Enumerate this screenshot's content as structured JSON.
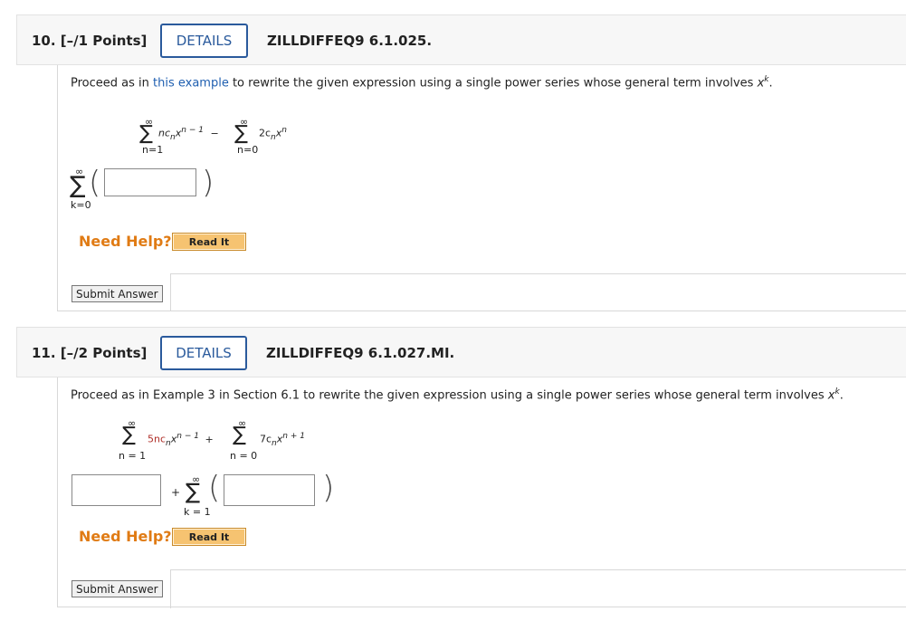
{
  "q10": {
    "number": "10.  [–/1 Points]",
    "details": "DETAILS",
    "code": "ZILLDIFFEQ9 6.1.025.",
    "prompt_before": "Proceed as in ",
    "prompt_link": "this example",
    "prompt_after": " to rewrite the given expression using a single power series whose general term involves ",
    "prompt_var": "x",
    "prompt_exp": "k",
    "prompt_end": ".",
    "expr": {
      "inf1": "∞",
      "inf2": "∞",
      "term1": "nc",
      "term1_sub": "n",
      "term1_x": "x",
      "term1_sup": "n − 1",
      "minus": "−",
      "term2": "2c",
      "term2_sub": "n",
      "term2_x": "x",
      "term2_sup": "n",
      "lim1": "n=1",
      "lim2": "n=0"
    },
    "answer": {
      "inf": "∞",
      "lim": "k=0",
      "value": ""
    },
    "need_help": "Need Help?",
    "read_it": "Read It",
    "submit": "Submit Answer"
  },
  "q11": {
    "number": "11.  [–/2 Points]",
    "details": "DETAILS",
    "code": "ZILLDIFFEQ9 6.1.027.MI.",
    "prompt": "Proceed as in Example 3 in Section 6.1 to rewrite the given expression using a single power series whose general term involves ",
    "prompt_var": "x",
    "prompt_exp": "k",
    "prompt_end": ".",
    "expr": {
      "inf1": "∞",
      "inf2": "∞",
      "term1": "5nc",
      "term1_sub": "n",
      "term1_x": "x",
      "term1_sup": "n − 1",
      "plus": "+",
      "term2": "7c",
      "term2_sub": "n",
      "term2_x": "x",
      "term2_sup": "n + 1",
      "lim1": "n = 1",
      "lim2": "n = 0"
    },
    "answer": {
      "plus": "+",
      "inf": "∞",
      "lim": "k = 1",
      "value1": "",
      "value2": ""
    },
    "need_help": "Need Help?",
    "read_it": "Read It",
    "submit": "Submit Answer"
  }
}
